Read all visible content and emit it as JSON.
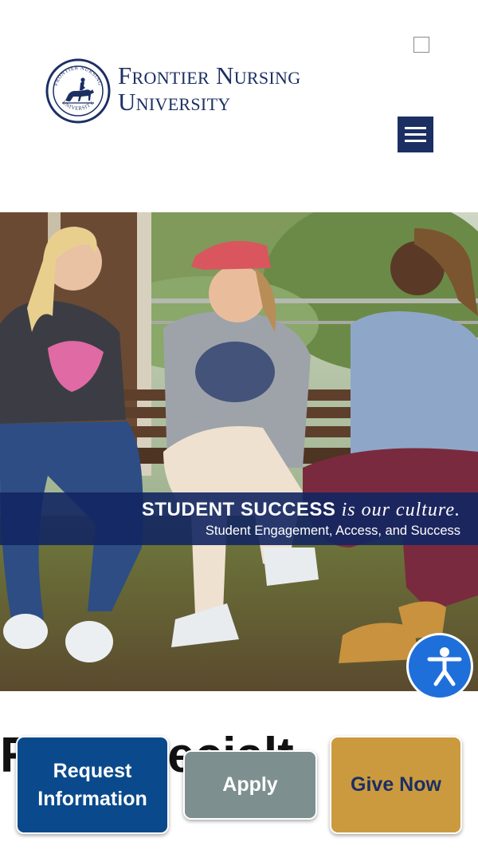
{
  "header": {
    "brand_line1": "Frontier Nursing",
    "brand_line2": "University",
    "seal_text_top": "FRONTIER NURSING",
    "seal_text_bottom": "UNIVERSITY"
  },
  "hero": {
    "banner_strong": "STUDENT SUCCESS",
    "banner_italic": "is our culture.",
    "banner_subtitle": "Student Engagement, Access, and Success"
  },
  "main": {
    "heading_partial": "Rec   Specialt"
  },
  "cta": {
    "request": "Request Information",
    "apply": "Apply",
    "give": "Give Now"
  },
  "colors": {
    "navy": "#1b2f63",
    "request_blue": "#0a4a8c",
    "apply_gray": "#7e8f90",
    "give_gold": "#cc9a3e",
    "accessibility_blue": "#1e6fd9"
  },
  "icons": {
    "menu": "hamburger-menu-icon",
    "accessibility": "accessibility-person-icon",
    "logo": "frontier-nursing-seal-icon"
  }
}
